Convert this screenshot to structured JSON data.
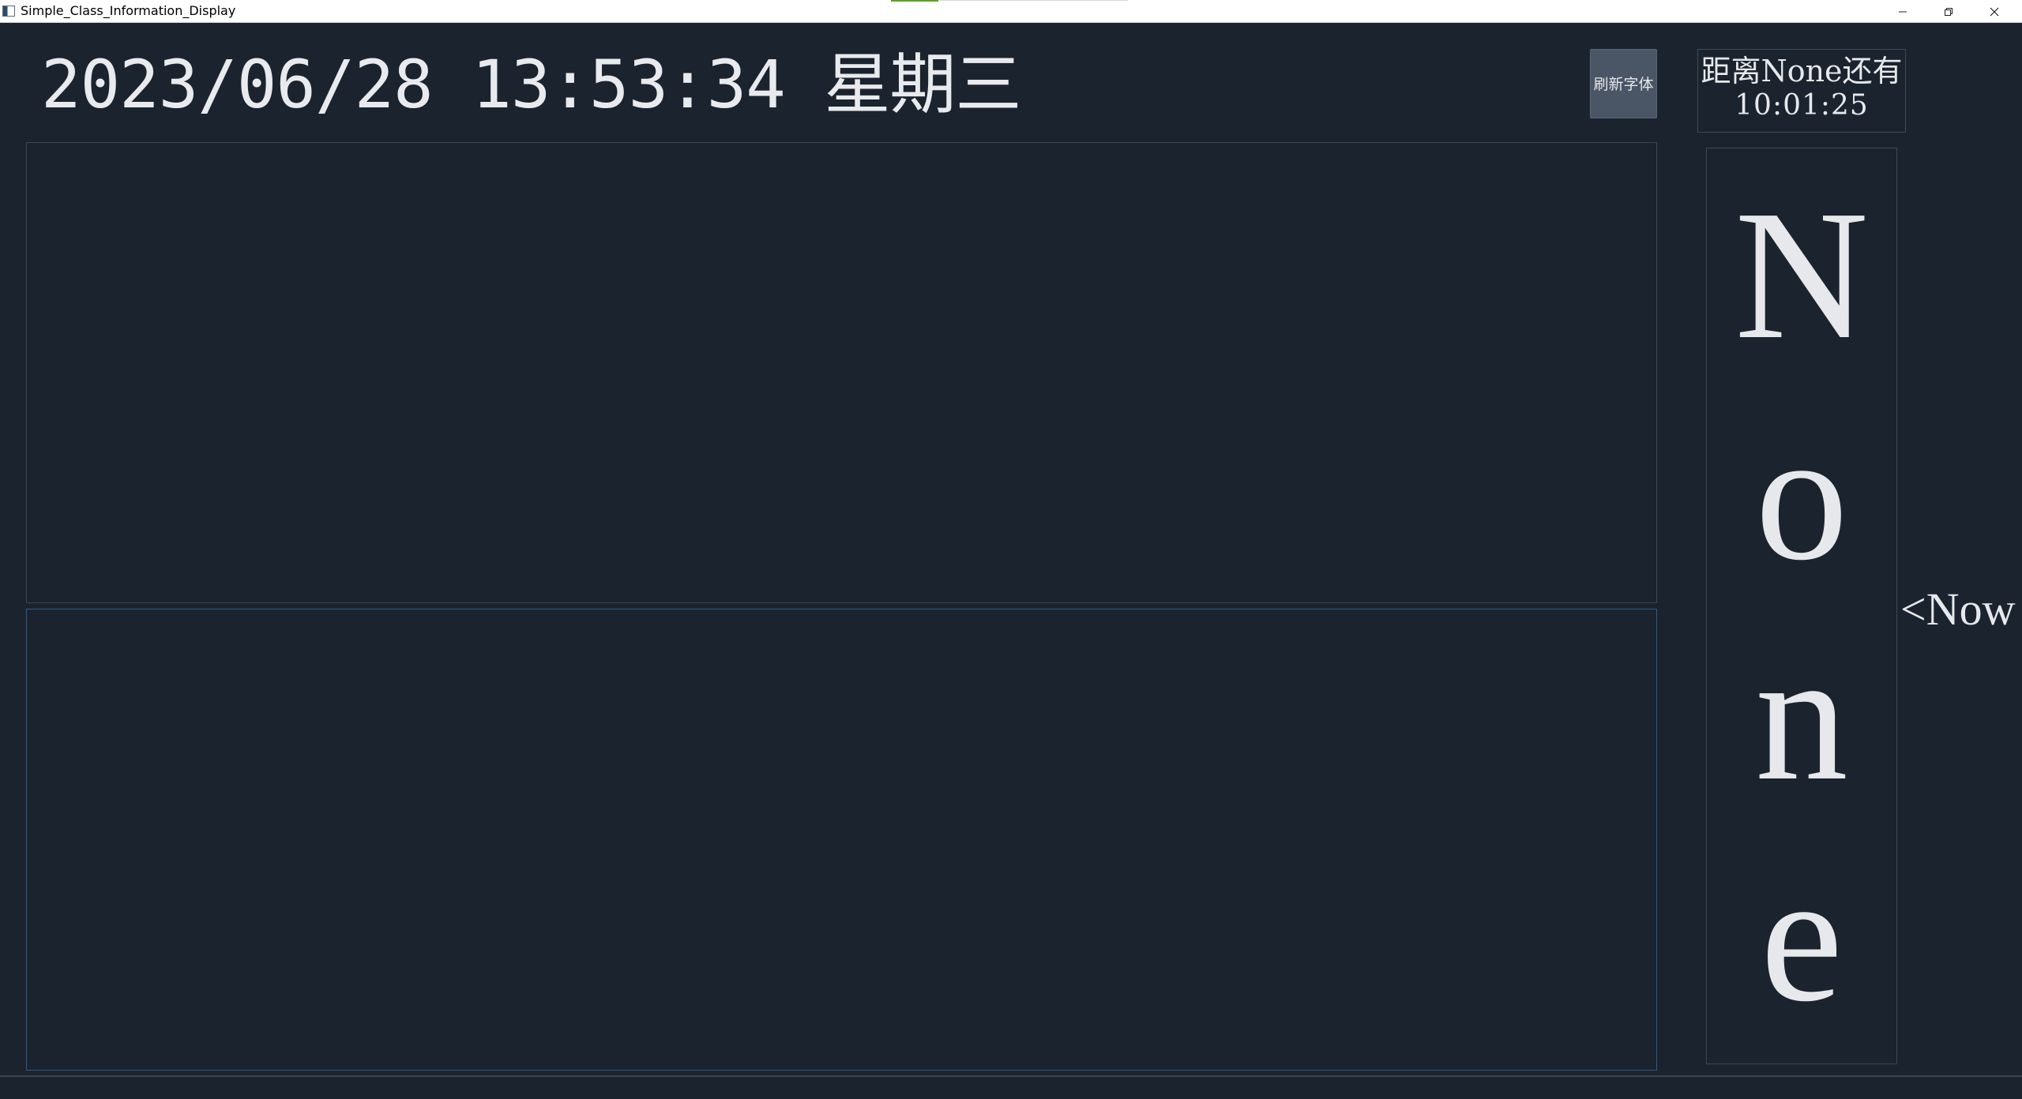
{
  "window": {
    "title": "Simple_Class_Information_Display",
    "icon": "app-window-icon",
    "controls": {
      "minimize": "minimize-icon",
      "maximize": "restore-icon",
      "close": "close-icon"
    }
  },
  "header": {
    "datetime": "2023/06/28 13:53:34 星期三",
    "refresh_button_label": "刷新字体"
  },
  "countdown": {
    "line1": "距离None还有",
    "line2": "10:01:25"
  },
  "current_class": {
    "chars": [
      "N",
      "o",
      "n",
      "e"
    ]
  },
  "now_label": "<Now",
  "colors": {
    "background": "#1b232e",
    "text": "#e6e8eb",
    "button": "#4a5566",
    "panel_border": "#3d4753",
    "panel_focus_border": "#2d5a8a"
  }
}
